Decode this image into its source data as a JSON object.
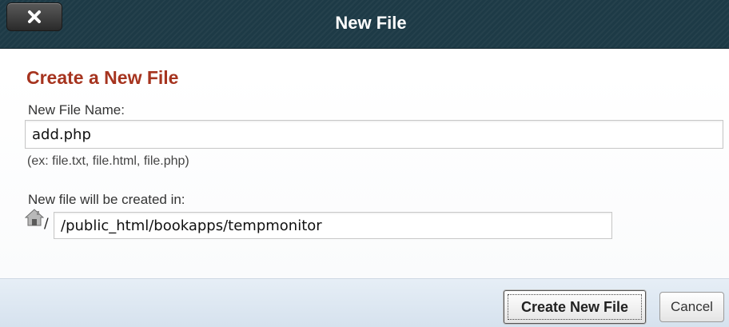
{
  "dialog": {
    "title": "New File",
    "close_icon": "close-x-icon"
  },
  "form": {
    "heading": "Create a New File",
    "filename_label": "New File Name:",
    "filename_value": "add.php",
    "filename_hint": "(ex: file.txt, file.html, file.php)",
    "location_label": "New file will be created in:",
    "location_icon": "home-icon",
    "location_prefix": "/",
    "location_value": "/public_html/bookapps/tempmonitor"
  },
  "footer": {
    "create_label": "Create New File",
    "cancel_label": "Cancel"
  },
  "colors": {
    "titlebar_bg": "#1d3a46",
    "heading": "#a6341f",
    "footer_bg": "#dde7f1"
  }
}
